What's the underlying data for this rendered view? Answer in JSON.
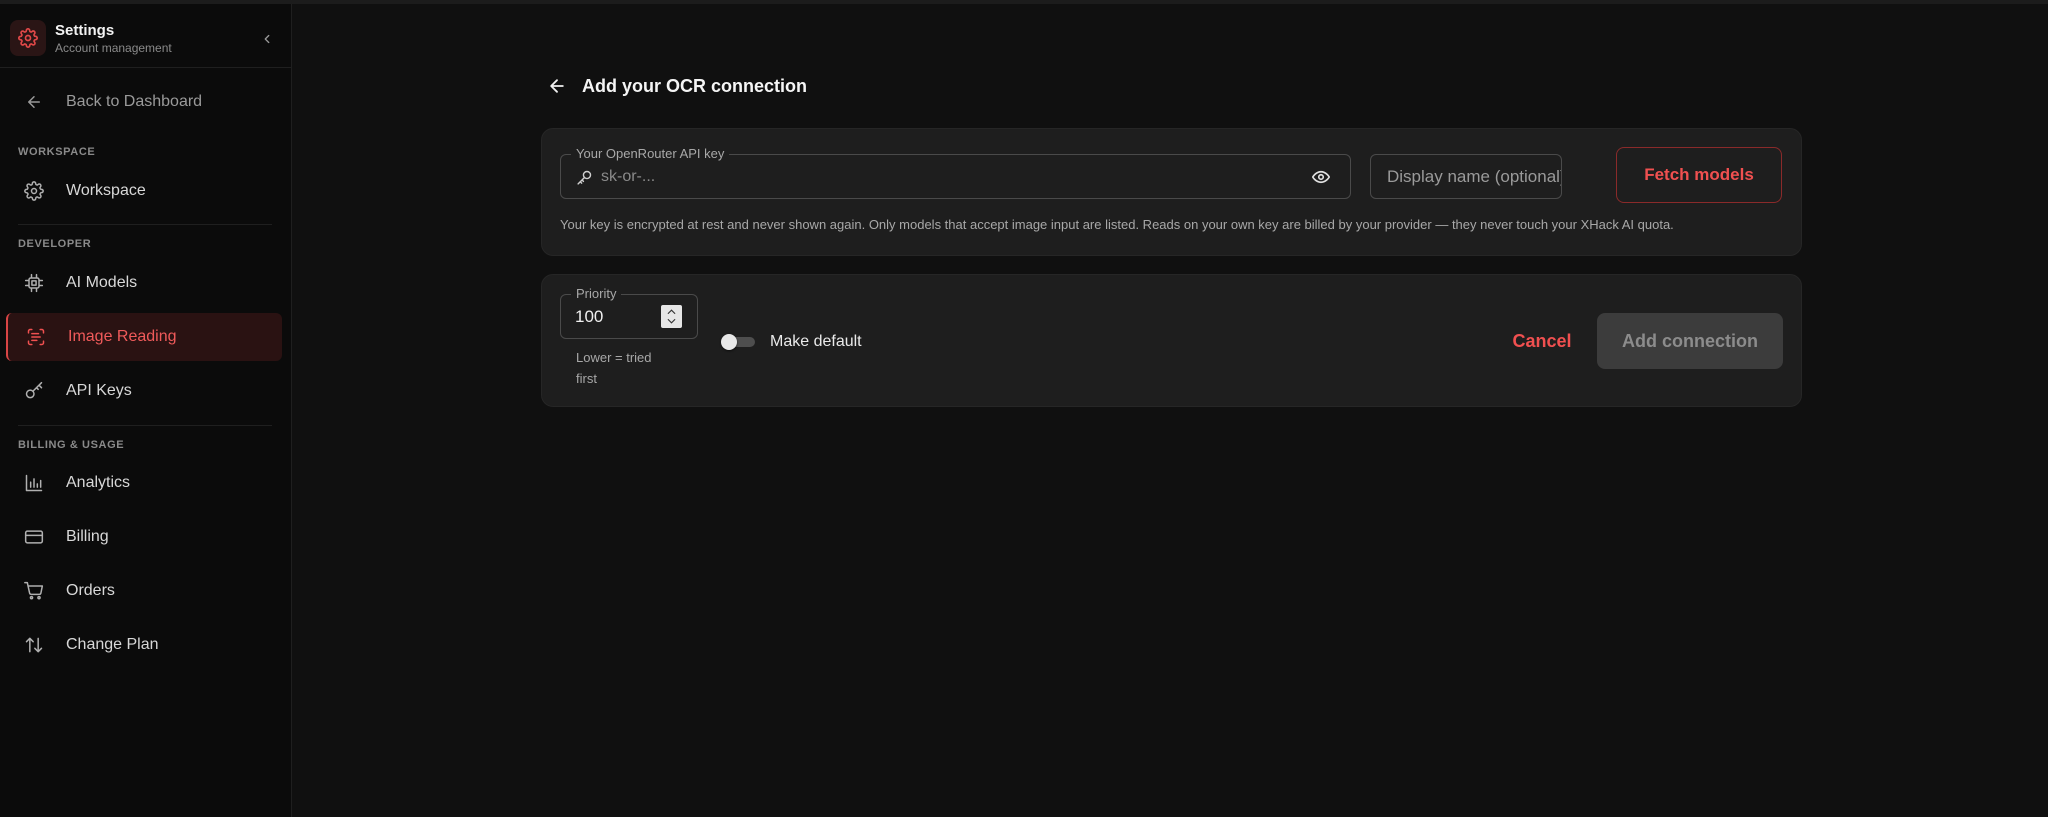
{
  "sidebar": {
    "title": "Settings",
    "subtitle": "Account management",
    "back_label": "Back to Dashboard",
    "sections": {
      "workspace": "WORKSPACE",
      "developer": "DEVELOPER",
      "billing": "BILLING & USAGE"
    },
    "items": {
      "workspace": "Workspace",
      "ai_models": "AI Models",
      "image_reading": "Image Reading",
      "api_keys": "API Keys",
      "analytics": "Analytics",
      "billing": "Billing",
      "orders": "Orders",
      "change_plan": "Change Plan"
    },
    "active_item": "image_reading"
  },
  "page": {
    "title": "Add your OCR connection"
  },
  "api_key": {
    "label": "Your OpenRouter API key",
    "value": "",
    "placeholder": "sk-or-..."
  },
  "display_name": {
    "value": "",
    "placeholder": "Display name (optional)"
  },
  "fetch_label": "Fetch models",
  "helper_text": "Your key is encrypted at rest and never shown again. Only models that accept image input are listed. Reads on your own key are billed by your provider — they never touch your XHack AI quota.",
  "priority": {
    "label": "Priority",
    "value": "100",
    "hint": "Lower = tried first"
  },
  "make_default": {
    "label": "Make default",
    "checked": false
  },
  "actions": {
    "cancel": "Cancel",
    "add": "Add connection"
  },
  "colors": {
    "accent": "#f05050",
    "active_bg": "#2a1212",
    "card_bg": "#1e1e1e",
    "page_bg": "#101010"
  }
}
